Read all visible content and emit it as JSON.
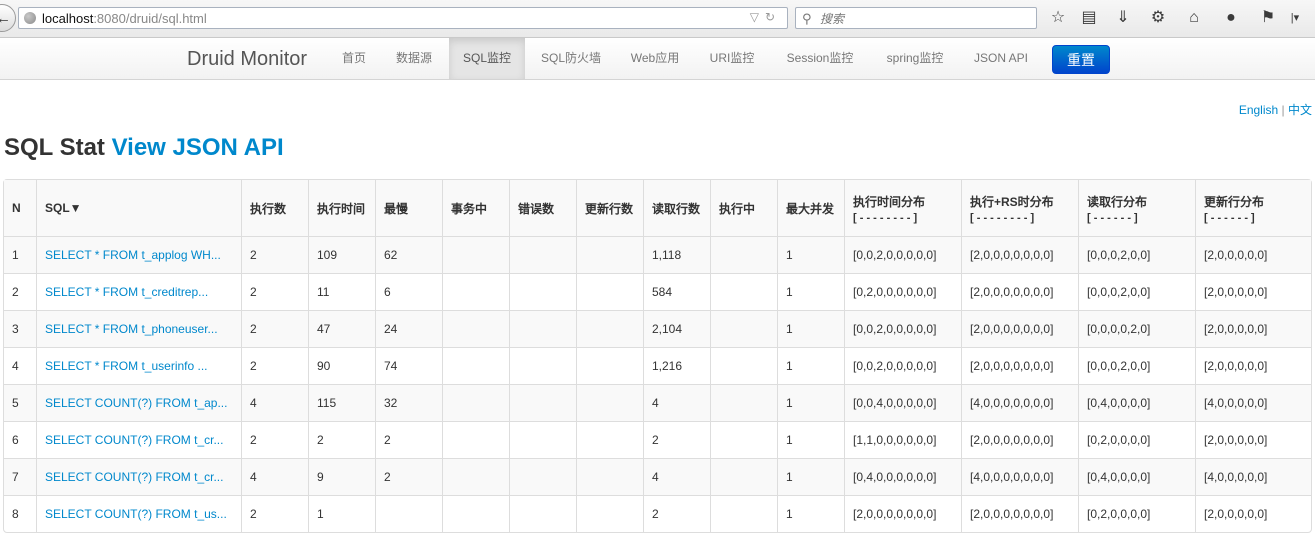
{
  "browser": {
    "url_host": "localhost",
    "url_rest": ":8080/druid/sql.html",
    "search_placeholder": "搜索"
  },
  "nav": {
    "brand": "Druid Monitor",
    "items": [
      "首页",
      "数据源",
      "SQL监控",
      "SQL防火墙",
      "Web应用",
      "URI监控",
      "Session监控",
      "spring监控",
      "JSON API"
    ],
    "active_index": 2,
    "reset_label": "重置"
  },
  "lang": {
    "english": "English",
    "sep": "|",
    "chinese": "中文"
  },
  "heading": {
    "prefix": "SQL Stat",
    "link": "View JSON API"
  },
  "table": {
    "headers": [
      "N",
      "SQL▼",
      "执行数",
      "执行时间",
      "最慢",
      "事务中",
      "错误数",
      "更新行数",
      "读取行数",
      "执行中",
      "最大并发",
      "执行时间分布",
      "执行+RS时分布",
      "读取行分布",
      "更新行分布"
    ],
    "header_subs": [
      "",
      "",
      "",
      "",
      "",
      "",
      "",
      "",
      "",
      "",
      "",
      "[ - - - - - - - - ]",
      "[ - - - - - - - - ]",
      "[ - - - - - - ]",
      "[ - - - - - - ]"
    ],
    "rows": [
      [
        "1",
        "SELECT * FROM t_applog WH...",
        "2",
        "109",
        "62",
        "",
        "",
        "",
        "1,118",
        "",
        "1",
        "[0,0,2,0,0,0,0,0]",
        "[2,0,0,0,0,0,0,0]",
        "[0,0,0,2,0,0]",
        "[2,0,0,0,0,0]"
      ],
      [
        "2",
        "SELECT * FROM t_creditrep...",
        "2",
        "11",
        "6",
        "",
        "",
        "",
        "584",
        "",
        "1",
        "[0,2,0,0,0,0,0,0]",
        "[2,0,0,0,0,0,0,0]",
        "[0,0,0,2,0,0]",
        "[2,0,0,0,0,0]"
      ],
      [
        "3",
        "SELECT * FROM t_phoneuser...",
        "2",
        "47",
        "24",
        "",
        "",
        "",
        "2,104",
        "",
        "1",
        "[0,0,2,0,0,0,0,0]",
        "[2,0,0,0,0,0,0,0]",
        "[0,0,0,0,2,0]",
        "[2,0,0,0,0,0]"
      ],
      [
        "4",
        "SELECT * FROM t_userinfo ...",
        "2",
        "90",
        "74",
        "",
        "",
        "",
        "1,216",
        "",
        "1",
        "[0,0,2,0,0,0,0,0]",
        "[2,0,0,0,0,0,0,0]",
        "[0,0,0,2,0,0]",
        "[2,0,0,0,0,0]"
      ],
      [
        "5",
        "SELECT COUNT(?) FROM t_ap...",
        "4",
        "115",
        "32",
        "",
        "",
        "",
        "4",
        "",
        "1",
        "[0,0,4,0,0,0,0,0]",
        "[4,0,0,0,0,0,0,0]",
        "[0,4,0,0,0,0]",
        "[4,0,0,0,0,0]"
      ],
      [
        "6",
        "SELECT COUNT(?) FROM t_cr...",
        "2",
        "2",
        "2",
        "",
        "",
        "",
        "2",
        "",
        "1",
        "[1,1,0,0,0,0,0,0]",
        "[2,0,0,0,0,0,0,0]",
        "[0,2,0,0,0,0]",
        "[2,0,0,0,0,0]"
      ],
      [
        "7",
        "SELECT COUNT(?) FROM t_cr...",
        "4",
        "9",
        "2",
        "",
        "",
        "",
        "4",
        "",
        "1",
        "[0,4,0,0,0,0,0,0]",
        "[4,0,0,0,0,0,0,0]",
        "[0,4,0,0,0,0]",
        "[4,0,0,0,0,0]"
      ],
      [
        "8",
        "SELECT COUNT(?) FROM t_us...",
        "2",
        "1",
        "",
        "",
        "",
        "",
        "2",
        "",
        "1",
        "[2,0,0,0,0,0,0,0]",
        "[2,0,0,0,0,0,0,0]",
        "[0,2,0,0,0,0]",
        "[2,0,0,0,0,0]"
      ]
    ]
  }
}
